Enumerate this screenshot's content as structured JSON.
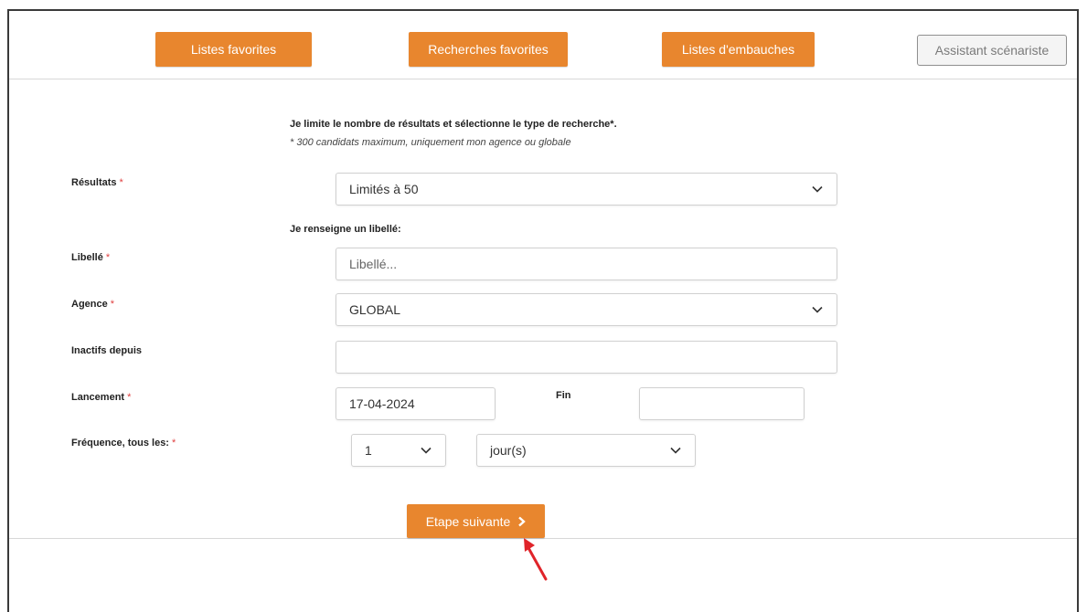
{
  "toolbar": {
    "favorite_lists": "Listes favorites",
    "favorite_searches": "Recherches favorites",
    "hiring_lists": "Listes d'embauches",
    "script_assistant": "Assistant scénariste"
  },
  "intro": {
    "title": "Je limite le nombre de résultats et sélectionne le type de recherche*.",
    "note": "* 300 candidats maximum, uniquement mon agence ou globale"
  },
  "form": {
    "results": {
      "label": "Résultats",
      "required_mark": "*",
      "value": "Limités à 50"
    },
    "libelle_section": "Je renseigne un libellé:",
    "libelle": {
      "label": "Libellé",
      "required_mark": "*",
      "placeholder": "Libellé...",
      "value": ""
    },
    "agence": {
      "label": "Agence",
      "required_mark": "*",
      "value": "GLOBAL"
    },
    "inactifs": {
      "label": "Inactifs depuis",
      "value": ""
    },
    "lancement": {
      "label": "Lancement",
      "required_mark": "*",
      "value": "17-04-2024"
    },
    "fin": {
      "label": "Fin",
      "value": ""
    },
    "frequence": {
      "label": "Fréquence, tous les:",
      "required_mark": "*",
      "count": "1",
      "unit": "jour(s)"
    }
  },
  "actions": {
    "next_step": "Etape suivante"
  },
  "colors": {
    "accent": "#e8862e",
    "required": "#e04040",
    "annotation_arrow": "#e0242a"
  }
}
